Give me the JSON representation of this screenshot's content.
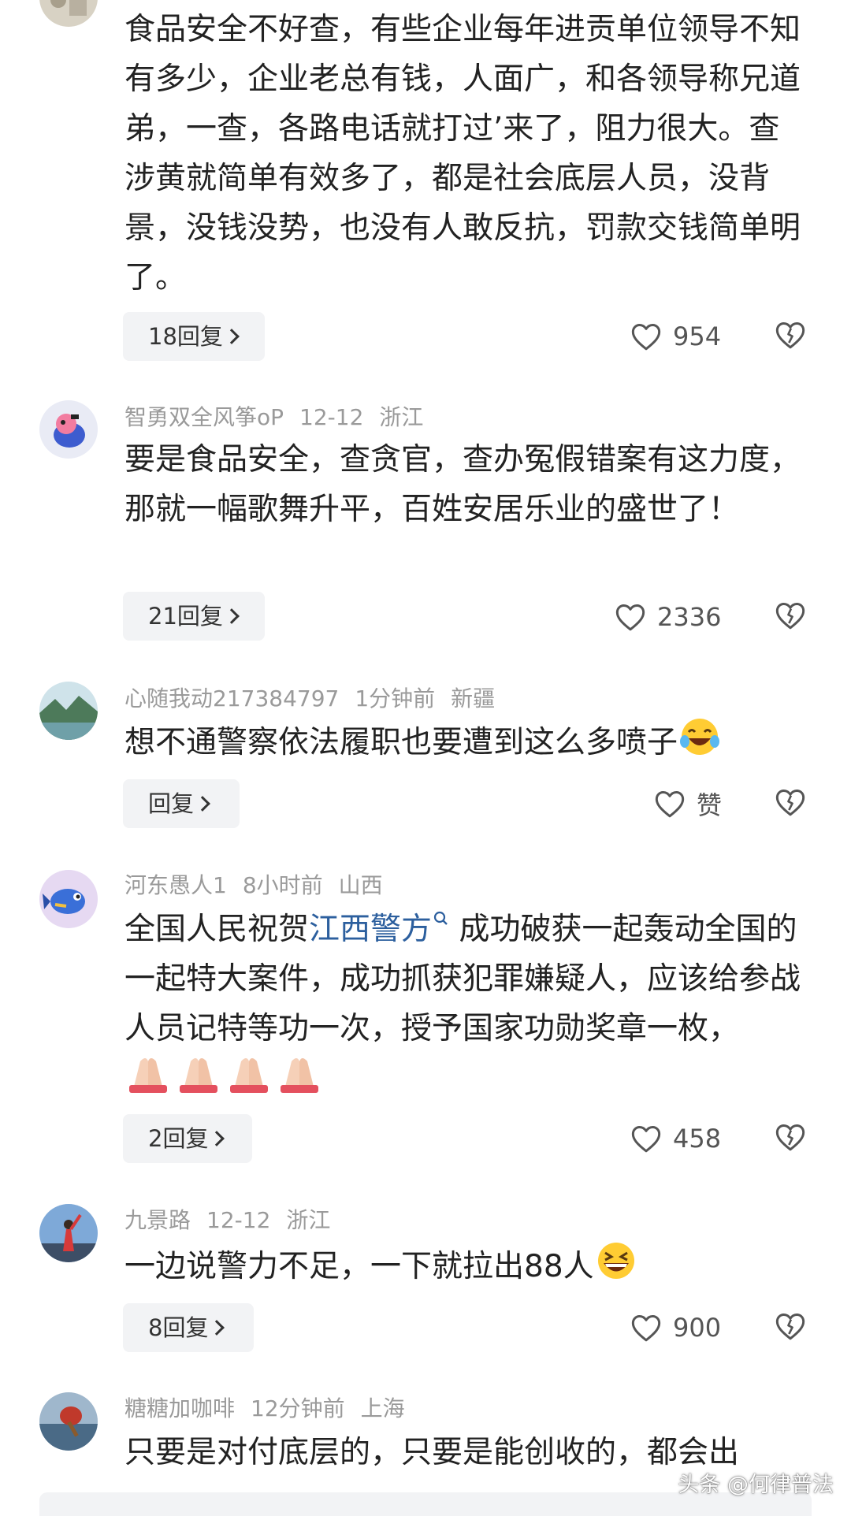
{
  "comments": [
    {
      "user": "",
      "time": "",
      "location": "",
      "text": "食品安全不好查，有些企业每年进贡单位领导不知有多少，企业老总有钱，人面广，和各领导称兄道弟，一查，各路电话就打过’来了，阻力很大。查涉黄就简单有效多了，都是社会底层人员，没背景，没钱没势，也没有人敢反抗，罚款交钱简单明了。",
      "reply_label": "18回复",
      "likes": "954"
    },
    {
      "user": "智勇双全风筝oP",
      "time": "12-12",
      "location": "浙江",
      "text": "要是食品安全，查贪官，查办冤假错案有这力度，那就一幅歌舞升平，百姓安居乐业的盛世了！",
      "reply_label": "21回复",
      "likes": "2336"
    },
    {
      "user": "心随我动217384797",
      "time": "1分钟前",
      "location": "新疆",
      "text": "想不通警察依法履职也要遭到这么多喷子",
      "reply_label": "回复",
      "likes": "赞"
    },
    {
      "user": "河东愚人1",
      "time": "8小时前",
      "location": "山西",
      "text_before": "全国人民祝贺",
      "topic": "江西警方",
      "text_after": "成功破获一起轰动全国的一起特大案件，成功抓获犯罪嫌疑人，应该给参战人员记特等功一次，授予国家功勋奖章一枚，",
      "reply_label": "2回复",
      "likes": "458"
    },
    {
      "user": "九景路",
      "time": "12-12",
      "location": "浙江",
      "text": "一边说警力不足，一下就拉出88人",
      "reply_label": "8回复",
      "likes": "900"
    },
    {
      "user": "糖糖加咖啡",
      "time": "12分钟前",
      "location": "上海",
      "text": "只要是对付底层的，只要是能创收的，都会出"
    }
  ],
  "watermark": "头条 @何律普法",
  "icons": {
    "like": "heart-outline-icon",
    "dislike": "broken-heart-icon",
    "topic_search": "search-icon",
    "laugh_cry": "laughing-crying-emoji",
    "pray": "folded-hands-emoji",
    "grin": "grinning-squinting-emoji"
  },
  "colors": {
    "text": "#222222",
    "meta": "#9a9a9a",
    "link": "#2c5f9e",
    "button_bg": "#f2f3f5"
  }
}
